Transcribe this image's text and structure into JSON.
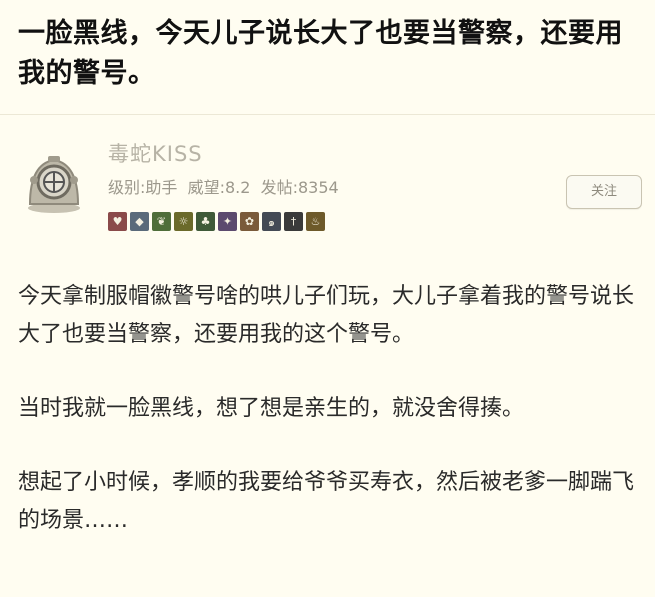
{
  "headline": "一脸黑线，今天儿子说长大了也要当警察，还要用我的警号。",
  "user": {
    "name": "毒蛇KISS",
    "meta": "级别:助手  威望:8.2  发帖:8354",
    "follow_label": "关注"
  },
  "badges": [
    "heart-badge",
    "shield-badge",
    "leaf-badge",
    "sun-badge",
    "tree-badge",
    "bird-badge",
    "flower-badge",
    "swirl-badge",
    "sword-badge",
    "flame-badge"
  ],
  "post": {
    "paragraphs": [
      "今天拿制服帽徽警号啥的哄儿子们玩，大儿子拿着我的警号说长大了也要当警察，还要用我的这个警号。",
      "当时我就一脸黑线，想了想是亲生的，就没舍得揍。",
      "想起了小时候，孝顺的我要给爷爷买寿衣，然后被老爹一脚踹飞的场景……"
    ]
  },
  "colors": {
    "background": "#fffdf1",
    "username": "#b7b3a6",
    "meta": "#9c988c"
  }
}
